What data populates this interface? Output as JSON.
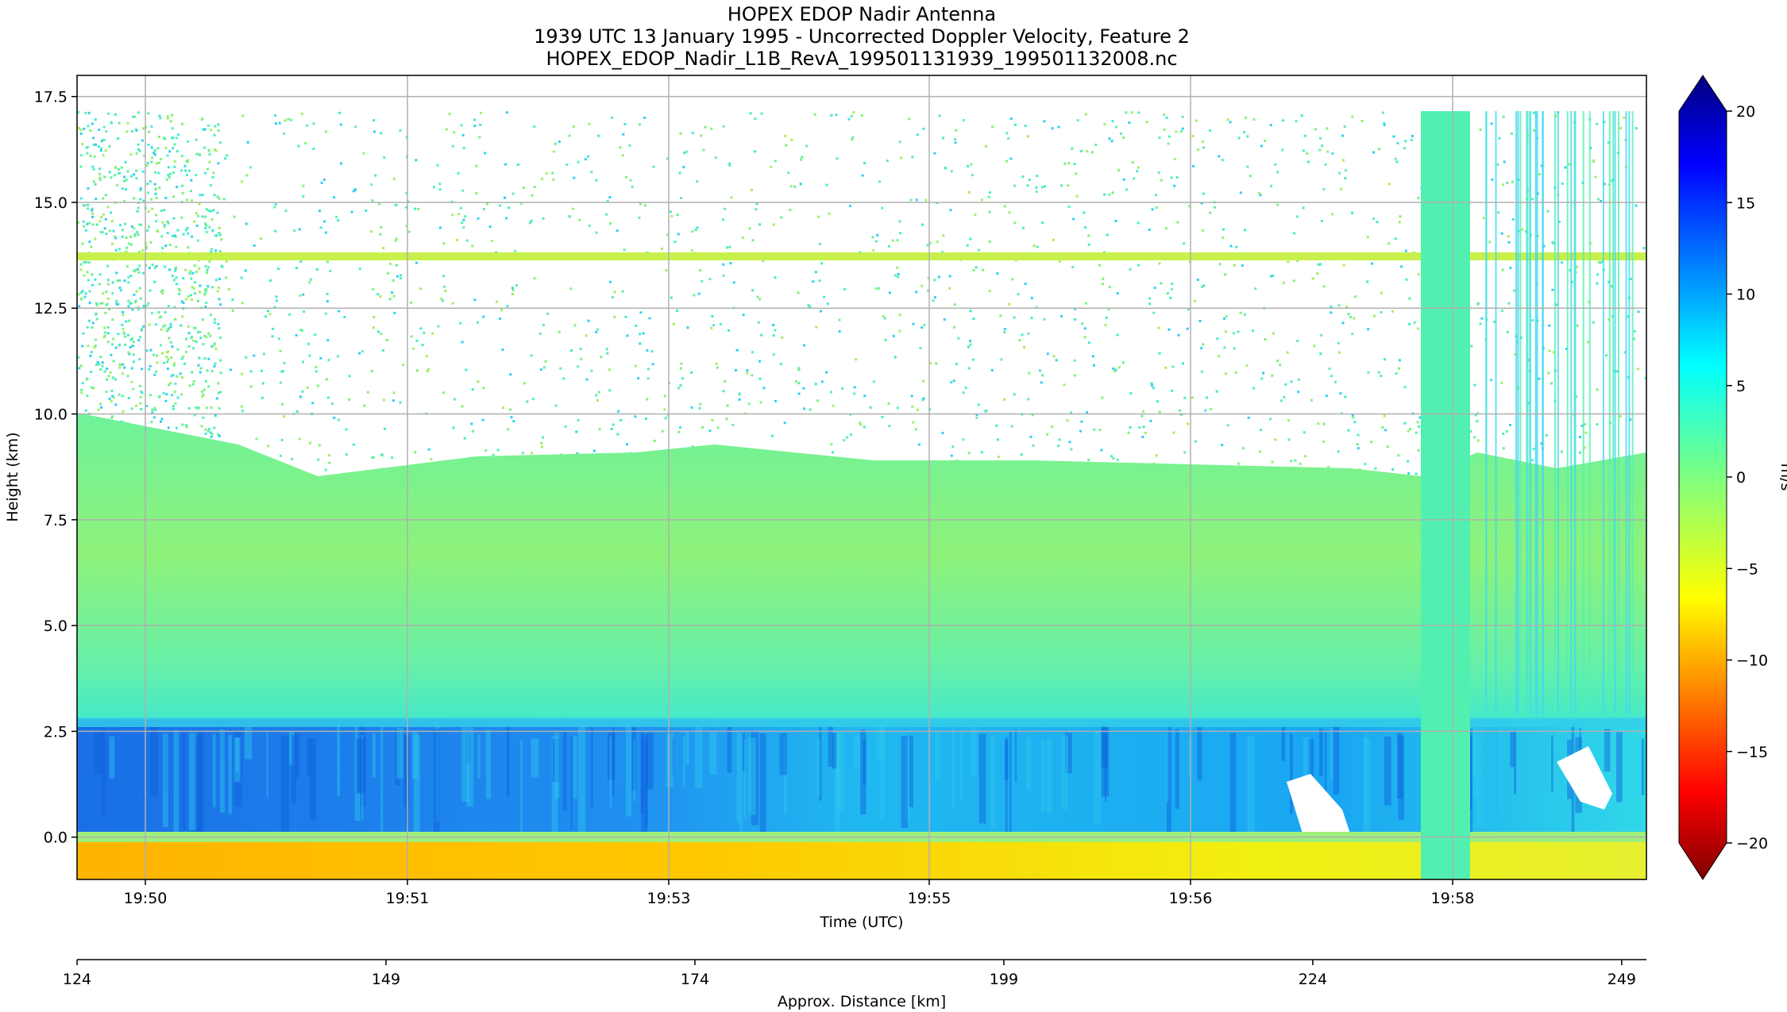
{
  "chart_data": {
    "type": "heatmap",
    "title": "HOPEX EDOP Nadir Antenna",
    "subtitle": "1939 UTC 13 January 1995 - Uncorrected Doppler Velocity, Feature 2",
    "filename": "HOPEX_EDOP_Nadir_L1B_RevA_199501131939_199501132008.nc",
    "xlabel": "Time (UTC)",
    "ylabel": "Height (km)",
    "x2label": "Approx. Distance [km]",
    "xticks": [
      "19:50",
      "19:51",
      "19:53",
      "19:55",
      "19:56",
      "19:58"
    ],
    "yticks": [
      "0.0",
      "2.5",
      "5.0",
      "7.5",
      "10.0",
      "12.5",
      "15.0",
      "17.5"
    ],
    "x2ticks": [
      "124",
      "149",
      "174",
      "199",
      "224",
      "249"
    ],
    "ylim": [
      -1.0,
      18.0
    ],
    "x2lim": [
      124,
      251
    ],
    "grid": true,
    "colorbar": {
      "label": "m/s",
      "range": [
        -20,
        20
      ],
      "ticks": [
        "20",
        "15",
        "10",
        "5",
        "0",
        "−10",
        "−15",
        "−20",
        "−5"
      ],
      "colormap": "jet",
      "extend": "both"
    },
    "layers": [
      {
        "feature": "surface return (below ground)",
        "height_km": [
          -1.0,
          0.0
        ],
        "velocity_ms": -8
      },
      {
        "feature": "ground line",
        "height_km": [
          -0.1,
          0.1
        ],
        "velocity_ms": -3
      },
      {
        "feature": "rain layer",
        "height_km": [
          0.1,
          2.8
        ],
        "velocity_ms": 9
      },
      {
        "feature": "melting layer / cloud",
        "height_km": [
          2.8,
          8.5
        ],
        "velocity_ms": 1
      },
      {
        "feature": "sparse echoes",
        "height_km": [
          8.5,
          17.2
        ],
        "velocity_ms": 3
      },
      {
        "feature": "artifact line",
        "height_km": [
          13.6,
          13.8
        ],
        "velocity_ms": -4
      }
    ],
    "colors": {
      "colorbar_stops": [
        "#7f0000",
        "#ff0000",
        "#ff7f00",
        "#ffff00",
        "#7fff7f",
        "#00ffff",
        "#007fff",
        "#0000ff",
        "#00007f"
      ]
    }
  }
}
